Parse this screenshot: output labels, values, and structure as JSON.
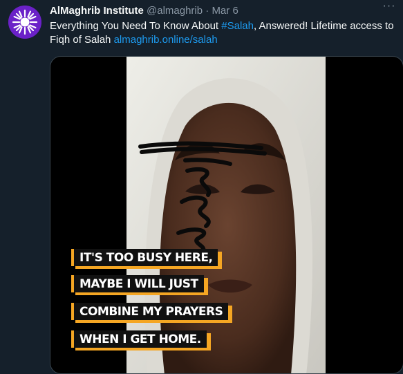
{
  "tweet": {
    "author_name": "AlMaghrib Institute",
    "handle": "@almaghrib",
    "separator": "·",
    "date": "Mar 6",
    "text_before": "Everything You Need To Know About ",
    "hashtag": "#Salah",
    "text_after": ", Answered! Lifetime access to Fiqh of Salah ",
    "link": "almaghrib.online/salah",
    "more_label": "···"
  },
  "media": {
    "captions": [
      "IT'S TOO BUSY HERE,",
      "MAYBE I WILL JUST",
      "COMBINE MY PRAYERS",
      "WHEN I GET HOME."
    ]
  },
  "colors": {
    "background": "#15202b",
    "link": "#1d9bf0",
    "avatar": "#6b21c8",
    "caption_accent": "#f5a623"
  },
  "icons": {
    "avatar": "sunburst-logo-icon",
    "more": "more-options-icon"
  }
}
